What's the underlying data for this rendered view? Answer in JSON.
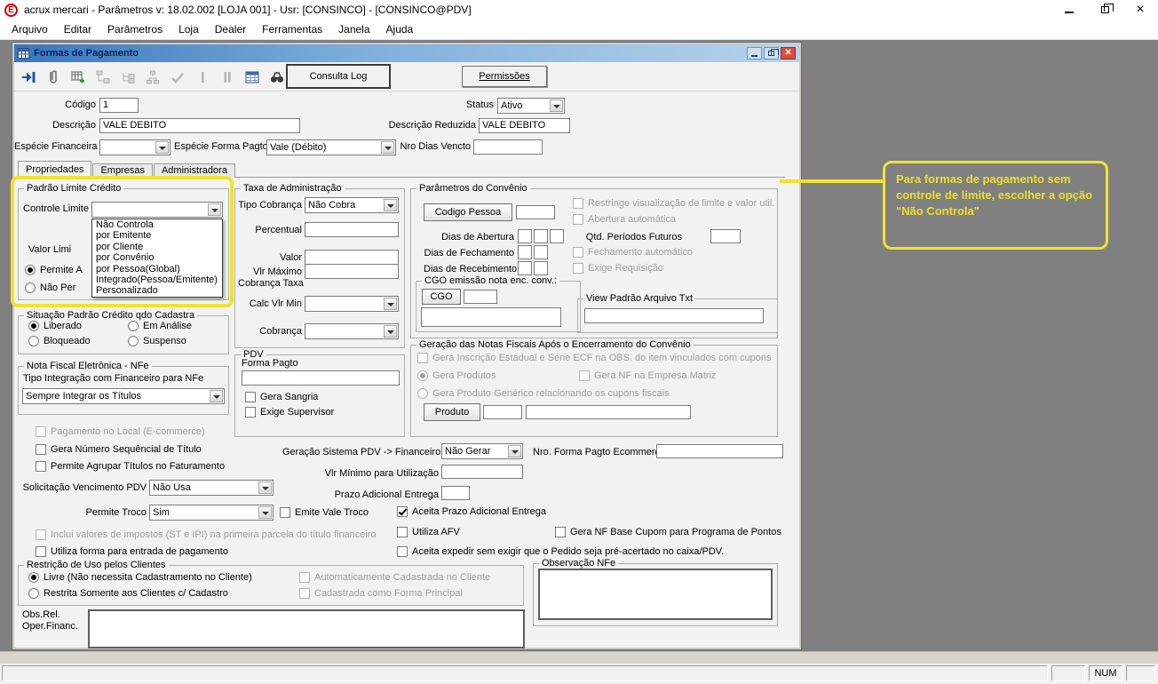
{
  "app": {
    "title": "acrux mercari - Parâmetros  v: 18.02.002   [LOJA 001] - Usr: [CONSINCO] - [CONSINCO@PDV]",
    "logo_letter": "E"
  },
  "menubar": {
    "items": [
      "Arquivo",
      "Editar",
      "Parâmetros",
      "Loja",
      "Dealer",
      "Ferramentas",
      "Janela",
      "Ajuda"
    ]
  },
  "child_window": {
    "title": "Formas de Pagamento"
  },
  "toolbar": {
    "consulta_log_label": "Consulta Log",
    "permissoes_label": "Permissões"
  },
  "header": {
    "codigo": {
      "label": "Código",
      "value": "1"
    },
    "status": {
      "label": "Status",
      "value": "Ativo"
    },
    "descricao": {
      "label": "Descrição",
      "value": "VALE DEBITO"
    },
    "descricao_reduzida": {
      "label": "Descrição Reduzida",
      "value": "VALE DEBITO"
    },
    "especie_financeira": {
      "label": "Espécie Financeira",
      "value": ""
    },
    "especie_forma_pagto": {
      "label": "Espécie Forma Pagto",
      "value": "Vale (Débito)"
    },
    "nro_dias_vencto": {
      "label": "Nro Dias Vencto",
      "value": ""
    }
  },
  "tabs": {
    "active": "Propriedades",
    "items": [
      "Propriedades",
      "Empresas",
      "Administradora"
    ]
  },
  "padrao_limite_credito": {
    "title": "Padrão Limite Crédito",
    "controle_limite": {
      "label": "Controle Limite",
      "value": "",
      "open": true,
      "options": [
        "Não Controla",
        "por Emitente",
        "por Cliente",
        "por Convênio",
        "por Pessoa(Global)",
        "Integrado(Pessoa/Emitente)",
        "Personalizado"
      ]
    },
    "valor_limite_partial": "Valor Limi",
    "permite_partial": {
      "label": "Permite A",
      "selected": true
    },
    "nao_permite_partial": {
      "label": "Não Per",
      "selected": false
    }
  },
  "situacao_padrao_credito": {
    "title": "Situação Padrão Crédito qdo Cadastra",
    "liberado": {
      "label": "Liberado",
      "selected": true
    },
    "em_analise": {
      "label": "Em Análise",
      "selected": false
    },
    "bloqueado": {
      "label": "Bloqueado",
      "selected": false
    },
    "suspenso": {
      "label": "Suspenso",
      "selected": false
    }
  },
  "nota_fiscal_nfe": {
    "title": "Nota Fiscal Eletrônica - NFe",
    "tipo_integracao": {
      "label": "Tipo Integração com Financeiro para NFe",
      "value": "Sempre Integrar os Títulos"
    }
  },
  "opcoes_esquerda": {
    "pagamento_local": {
      "label": "Pagamento no Local (E-commerce)",
      "checked": false,
      "enabled": false
    },
    "gera_numero_sequencial": {
      "label": "Gera Número Sequêncial de Título",
      "checked": false,
      "enabled": true
    },
    "permite_agrupar": {
      "label": "Permite Agrupar Títulos no Faturamento",
      "checked": false,
      "enabled": true
    },
    "solicitacao_vencimento": {
      "label": "Solicitação Vencimento PDV",
      "value": "Não Usa"
    },
    "permite_troco": {
      "label": "Permite Troco",
      "value": "Sim"
    },
    "emite_vale_troco": {
      "label": "Emite Vale Troco",
      "checked": false,
      "enabled": true
    },
    "inclui_impostos": {
      "label": "Inclui valores de impostos (ST e IPI) na primeira parcela do título financeiro",
      "checked": false,
      "enabled": false
    },
    "utiliza_entrada": {
      "label": "Utiliza forma para entrada de pagamento",
      "checked": false,
      "enabled": true
    }
  },
  "restricao_uso": {
    "title": "Restrição de Uso pelos Clientes",
    "livre": {
      "label": "Livre (Não necessita Cadastramento no Cliente)",
      "selected": true
    },
    "restrita": {
      "label": "Restrita Somente aos Clientes c/ Cadastro",
      "selected": false
    },
    "auto_cadastrada": {
      "label": "Automaticamente Cadastrada no Cliente",
      "checked": false,
      "enabled": false
    },
    "forma_principal": {
      "label": "Cadastrada como Forma Principal",
      "checked": false,
      "enabled": false
    }
  },
  "obs_rel": {
    "label_linha1": "Obs.Rel.",
    "label_linha2": "Oper.Financ.",
    "value": ""
  },
  "taxa_administracao": {
    "title": "Taxa de Administração",
    "tipo_cobranca": {
      "label": "Tipo Cobrança",
      "value": "Não Cobra"
    },
    "percentual": {
      "label": "Percentual",
      "value": ""
    },
    "valor": {
      "label": "Valor",
      "value": ""
    },
    "vlr_maximo": {
      "label_linha1": "Vlr Máximo",
      "label_linha2": "Cobrança Taxa",
      "value": ""
    },
    "calc_vlr_min": {
      "label": "Calc Vlr Min",
      "value": ""
    },
    "cobranca": {
      "label": "Cobrança",
      "value": ""
    }
  },
  "pdv": {
    "title": "PDV",
    "forma_pagto": {
      "label": "Forma Pagto",
      "value": ""
    },
    "gera_sangria": {
      "label": "Gera Sangria",
      "checked": false,
      "enabled": true
    },
    "exige_supervisor": {
      "label": "Exige Supervisor",
      "checked": false,
      "enabled": true
    }
  },
  "parametros_convenio": {
    "title": "Parâmetros do Convênio",
    "codigo_pessoa_button": "Codigo Pessoa",
    "codigo_pessoa_value": "",
    "restringe_visualizacao": {
      "label": "Restringe visualização de limite e valor util.",
      "checked": false,
      "enabled": false
    },
    "abertura_automatica": {
      "label": "Abertura automática",
      "checked": false,
      "enabled": false
    },
    "dias_abertura_label": "Dias de Abertura",
    "qtd_periodos_futuros_label": "Qtd. Períodos Futuros",
    "dias_fechamento_label": "Dias de Fechamento",
    "fechamento_automatico": {
      "label": "Fechamento automático",
      "checked": false,
      "enabled": false
    },
    "dias_recebimento_label": "Dias de Recebimento",
    "exige_requisicao": {
      "label": "Exige Requisição",
      "checked": false,
      "enabled": false
    },
    "cgo_group_title": "CGO emissão nota enc. conv.:",
    "cgo_button": "CGO",
    "view_padrao_title": "View Padrão Arquivo Txt"
  },
  "geracao_notas_fiscais": {
    "title": "Geração das Notas Fiscais Após o Encerramento do Convênio",
    "gera_inscricao": {
      "label": "Gera Inscrição Estadual e Série ECF na OBS. do item vinculados com cupons",
      "checked": false,
      "enabled": false
    },
    "gera_produtos": {
      "label": "Gera Produtos",
      "selected": true,
      "enabled": false
    },
    "gera_nf_matriz": {
      "label": "Gera NF na Empresa Matriz",
      "checked": false,
      "enabled": false
    },
    "gera_produto_generico": {
      "label": "Gera Produto Genérico relacionando os cupons fiscais",
      "selected": false,
      "enabled": false
    },
    "produto_button": "Produto"
  },
  "rodape_direita": {
    "geracao_sistema_pdv": {
      "label": "Geração Sistema PDV -> Financeiro",
      "value": "Não Gerar"
    },
    "nro_forma_ecommerce": {
      "label": "Nro. Forma Pagto Ecommerce",
      "value": ""
    },
    "vlr_minimo_utilizacao": {
      "label": "Vlr Mínimo para Utilização",
      "value": ""
    },
    "prazo_adicional": {
      "label": "Prazo Adicional Entrega",
      "value": ""
    },
    "aceita_prazo": {
      "label": "Aceita Prazo Adicional Entrega",
      "checked": true,
      "enabled": true
    },
    "utiliza_afv": {
      "label": "Utiliza AFV",
      "checked": false,
      "enabled": true
    },
    "gera_nf_base_cupom": {
      "label": "Gera NF Base Cupom para Programa de Pontos",
      "checked": false,
      "enabled": true
    },
    "aceita_expedir": {
      "label": "Aceita expedir sem exigir que o Pedido seja pré-acertado no caixa/PDV.",
      "checked": false,
      "enabled": true
    },
    "observacao_nfe_title": "Observação NFe",
    "observacao_nfe_value": ""
  },
  "annotation": {
    "text": "Para formas de pagamento sem controle de limite, escolher a opção \"Não Controla\"",
    "color": "#efe32f"
  },
  "statusbar": {
    "num_label": "NUM"
  }
}
